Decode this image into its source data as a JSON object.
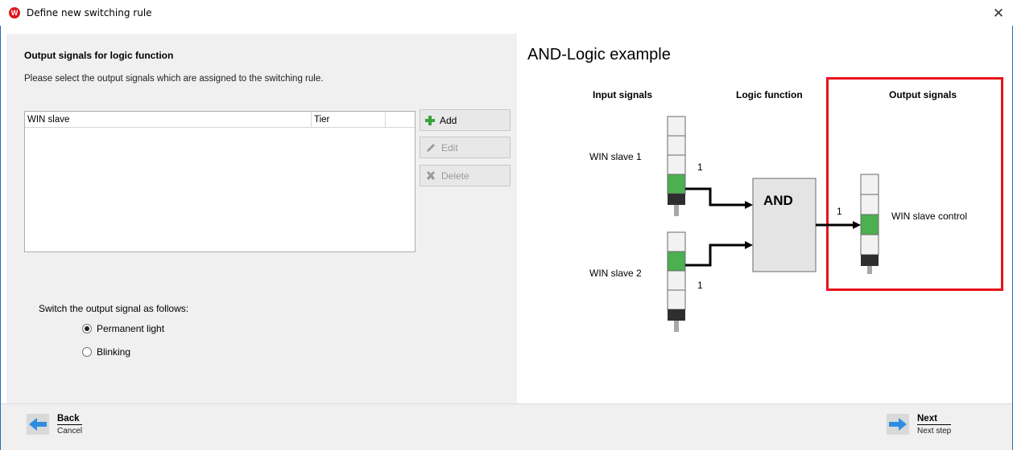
{
  "window": {
    "title": "Define new switching rule",
    "logo_text": "W",
    "close_glyph": "✕"
  },
  "left": {
    "section_title": "Output signals for logic function",
    "instructions": "Please select the output signals which are assigned to the switching rule.",
    "table": {
      "columns": [
        "WIN slave",
        "Tier",
        ""
      ],
      "rows": []
    },
    "buttons": {
      "add": "Add",
      "edit": "Edit",
      "delete": "Delete"
    },
    "switch_label": "Switch the output signal as follows:",
    "options": [
      {
        "label": "Permanent light",
        "checked": true
      },
      {
        "label": "Blinking",
        "checked": false
      }
    ]
  },
  "diagram": {
    "title": "AND-Logic example",
    "headings": {
      "inputs": "Input signals",
      "logic": "Logic function",
      "outputs": "Output signals"
    },
    "input1_label": "WIN slave 1",
    "input2_label": "WIN slave 2",
    "input1_value": "1",
    "input2_value": "1",
    "gate_label": "AND",
    "output_value": "1",
    "output_label": "WIN slave control",
    "highlight_color": "#e8111a",
    "green_color": "#4caf50"
  },
  "footer": {
    "back_label": "Back",
    "back_sub": "Cancel",
    "next_label": "Next",
    "next_sub": "Next step",
    "arrow_color": "#2e8de0"
  }
}
